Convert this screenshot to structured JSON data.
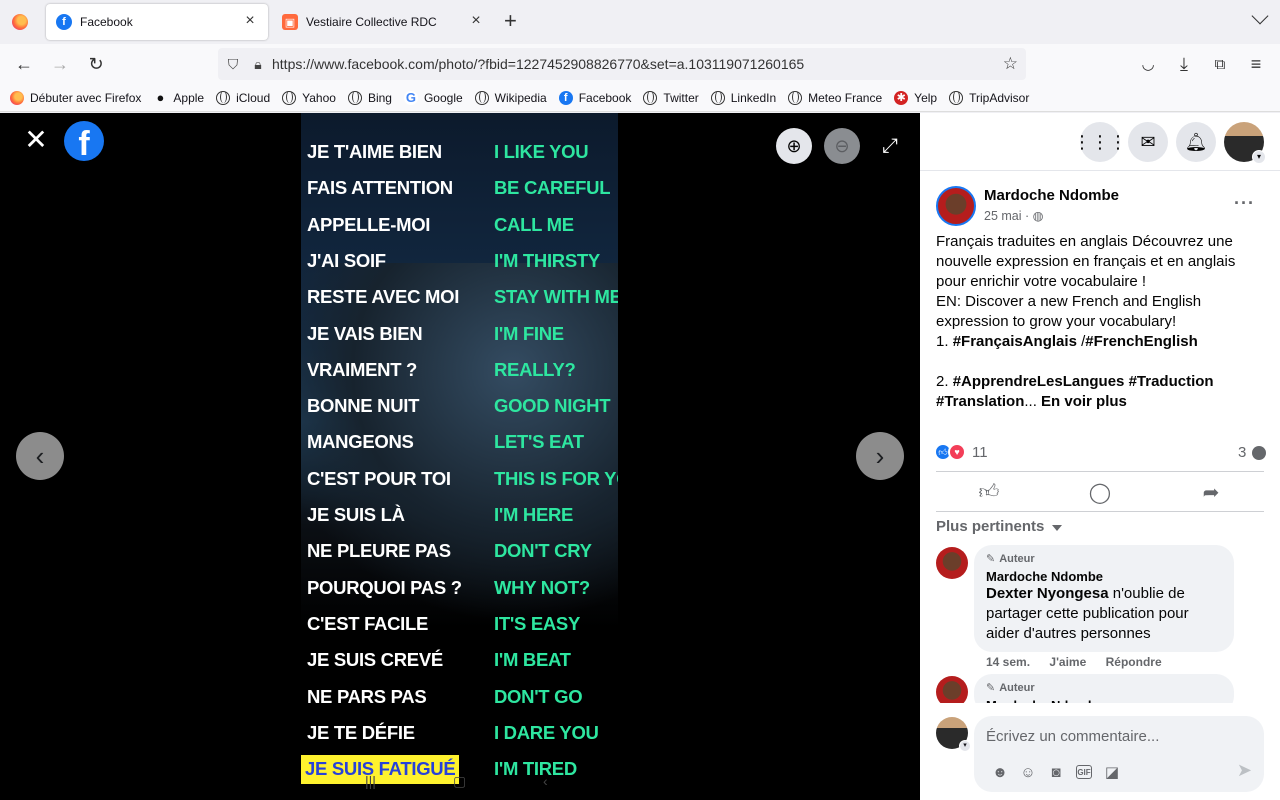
{
  "browser": {
    "tabs": [
      {
        "title": "Facebook",
        "favicon": "facebook-icon",
        "active": true
      },
      {
        "title": "Vestiaire Collective RDC",
        "favicon": "vestiaire-icon",
        "active": false
      }
    ],
    "url": "https://www.facebook.com/photo/?fbid=1227452908826770&set=a.103119071260165",
    "bookmarks": [
      {
        "label": "Débuter avec Firefox",
        "icon": "firefox-icon"
      },
      {
        "label": "Apple",
        "icon": "apple-icon"
      },
      {
        "label": "iCloud",
        "icon": "globe-icon"
      },
      {
        "label": "Yahoo",
        "icon": "globe-icon"
      },
      {
        "label": "Bing",
        "icon": "globe-icon"
      },
      {
        "label": "Google",
        "icon": "google-icon"
      },
      {
        "label": "Wikipedia",
        "icon": "globe-icon"
      },
      {
        "label": "Facebook",
        "icon": "facebook-icon"
      },
      {
        "label": "Twitter",
        "icon": "globe-icon"
      },
      {
        "label": "LinkedIn",
        "icon": "globe-icon"
      },
      {
        "label": "Meteo France",
        "icon": "globe-icon"
      },
      {
        "label": "Yelp",
        "icon": "yelp-icon"
      },
      {
        "label": "TripAdvisor",
        "icon": "globe-icon"
      }
    ]
  },
  "photo": {
    "rows": [
      {
        "fr": "JE T'AIME BIEN",
        "en": "I LIKE YOU"
      },
      {
        "fr": "FAIS ATTENTION",
        "en": "BE CAREFUL"
      },
      {
        "fr": "APPELLE-MOI",
        "en": "CALL ME"
      },
      {
        "fr": "J'AI SOIF",
        "en": "I'M THIRSTY"
      },
      {
        "fr": "RESTE AVEC MOI",
        "en": "STAY WITH ME"
      },
      {
        "fr": "JE VAIS BIEN",
        "en": "I'M FINE"
      },
      {
        "fr": "VRAIMENT ?",
        "en": "REALLY?"
      },
      {
        "fr": "BONNE NUIT",
        "en": "GOOD NIGHT"
      },
      {
        "fr": "MANGEONS",
        "en": "LET'S EAT"
      },
      {
        "fr": "C'EST POUR TOI",
        "en": "THIS IS FOR YOU"
      },
      {
        "fr": "JE SUIS LÀ",
        "en": "I'M HERE"
      },
      {
        "fr": "NE PLEURE PAS",
        "en": "DON'T CRY"
      },
      {
        "fr": "POURQUOI PAS ?",
        "en": "WHY NOT?"
      },
      {
        "fr": "C'EST FACILE",
        "en": "IT'S EASY"
      },
      {
        "fr": "JE SUIS CREVÉ",
        "en": "I'M BEAT"
      },
      {
        "fr": "NE PARS PAS",
        "en": "DON'T GO"
      },
      {
        "fr": "JE TE DÉFIE",
        "en": "I DARE YOU"
      },
      {
        "fr": "JE SUIS FATIGUÉ",
        "en": "I'M TIRED",
        "highlight": true
      }
    ],
    "colors": {
      "french": "#ffffff",
      "english": "#2ee6a0",
      "highlight_bg": "#fff22e",
      "highlight_text": "#2741d9"
    }
  },
  "post": {
    "author": "Mardoche Ndombe",
    "date": "25 mai",
    "privacy_icon": "globe-icon",
    "text_lines": [
      {
        "text": "Français traduites en anglais Découvrez une nouvelle expression en français et en anglais pour enrichir votre vocabulaire !"
      },
      {
        "text": "EN: Discover a new French and English expression to grow your vocabulary!"
      }
    ],
    "tags_line1_prefix": "1. ",
    "tag1": "#FrançaisAnglais",
    "tags_sep": " /",
    "tag2": "#FrenchEnglish",
    "tags_line2_prefix": "2. ",
    "tag3": "#ApprendreLesLangues",
    "tag4": "#Traduction",
    "tag5": "#Translation",
    "ellipsis": "...",
    "see_more": "En voir plus",
    "reaction_count": "11",
    "comment_count": "3"
  },
  "comments": {
    "filter_label": "Plus pertinents",
    "items": [
      {
        "badge": "Auteur",
        "author": "Mardoche Ndombe",
        "mention": "Dexter Nyongesa",
        "text": " n'oublie de partager cette publication pour aider d'autres personnes",
        "time": "14 sem.",
        "like": "J'aime",
        "reply": "Répondre"
      },
      {
        "badge": "Auteur",
        "author": "Mardoche Ndombe"
      }
    ],
    "composer_placeholder": "Écrivez un commentaire..."
  }
}
